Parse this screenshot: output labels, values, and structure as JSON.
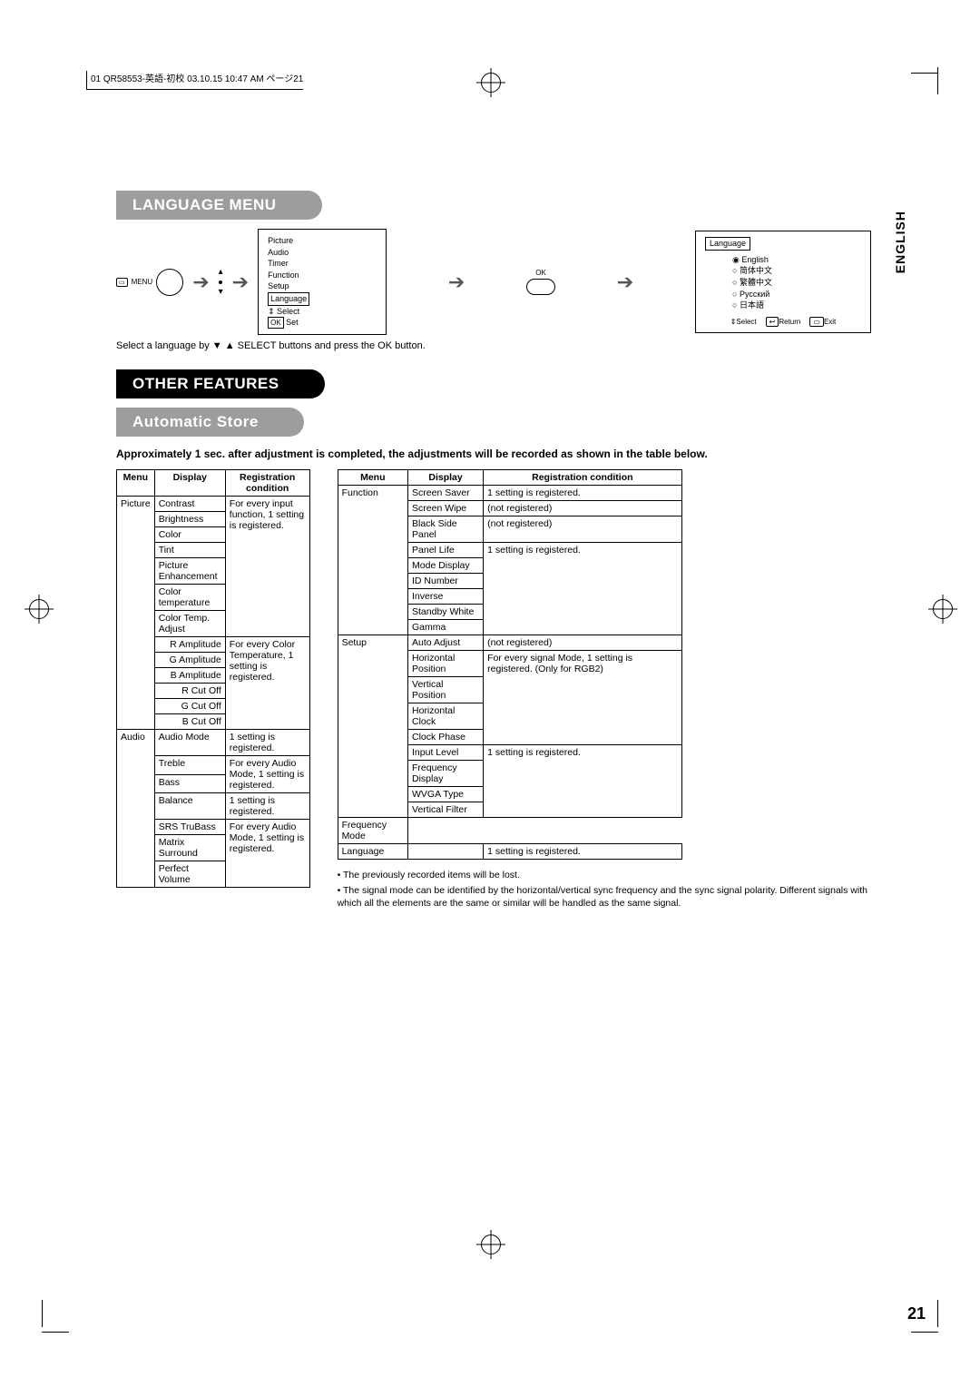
{
  "headerInfo": "01 QR58553-英語-初校  03.10.15  10:47 AM  ページ21",
  "langTab": "ENGLISH",
  "section1": "LANGUAGE MENU",
  "menuBtnLabel": "MENU",
  "okBtnLabel": "OK",
  "osdMenu": {
    "items": [
      "Picture",
      "Audio",
      "Timer",
      "Function",
      "Setup"
    ],
    "highlighted": "Language",
    "selectLabel": "Select",
    "setLabel": "Set",
    "okFrame": "OK"
  },
  "osdLanguage": {
    "title": "Language",
    "options": [
      "English",
      "简体中文",
      "繁體中文",
      "Русский",
      "日本語"
    ],
    "selectedIndex": 0,
    "footer": {
      "select": "Select",
      "return": "Return",
      "exit": "Exit"
    }
  },
  "caption1": "Select a language by ▼ ▲ SELECT buttons and press the OK button.",
  "section2": "OTHER FEATURES",
  "section3": "Automatic Store",
  "boldCaption": "Approximately 1 sec. after adjustment is completed, the adjustments will be recorded as shown in the table below.",
  "tableHeaders": {
    "menu": "Menu",
    "display": "Display",
    "cond": "Registration condition"
  },
  "tableLeft": [
    {
      "menu": "Picture",
      "display": "Contrast",
      "cond": "For every input function, 1 setting is registered.",
      "menuSpan": 13,
      "condSpan": 7
    },
    {
      "display": "Brightness"
    },
    {
      "display": "Color"
    },
    {
      "display": "Tint"
    },
    {
      "display": "Picture Enhancement"
    },
    {
      "display": "Color temperature"
    },
    {
      "display": "Color Temp. Adjust"
    },
    {
      "display": "R Amplitude",
      "cond": "For every Color Temperature, 1 setting is registered.",
      "condSpan": 6,
      "indent": true
    },
    {
      "display": "G Amplitude",
      "indent": true
    },
    {
      "display": "B Amplitude",
      "indent": true
    },
    {
      "display": "R Cut Off",
      "indent": true
    },
    {
      "display": "G Cut Off",
      "indent": true
    },
    {
      "display": "B Cut Off",
      "indent": true
    },
    {
      "menu": "Audio",
      "display": "Audio Mode",
      "cond": "1 setting is registered.",
      "menuSpan": 7
    },
    {
      "display": "Treble",
      "cond": "For every Audio Mode, 1 setting is registered.",
      "condSpan": 2
    },
    {
      "display": "Bass"
    },
    {
      "display": "Balance",
      "cond": "1 setting is registered."
    },
    {
      "display": "SRS TruBass",
      "cond": "For every Audio Mode, 1 setting is registered.",
      "condSpan": 3
    },
    {
      "display": "Matrix Surround"
    },
    {
      "display": "Perfect Volume"
    }
  ],
  "tableRight": [
    {
      "menu": "Function",
      "display": "Screen Saver",
      "cond": "1 setting is registered.",
      "menuSpan": 9
    },
    {
      "display": "Screen Wipe",
      "cond": "(not registered)"
    },
    {
      "display": "Black Side Panel",
      "cond": "(not registered)"
    },
    {
      "display": "Panel Life",
      "cond": "1 setting is registered.",
      "condSpan": 6
    },
    {
      "display": "Mode Display"
    },
    {
      "display": "ID Number"
    },
    {
      "display": "Inverse"
    },
    {
      "display": "Standby White"
    },
    {
      "display": "Gamma"
    },
    {
      "menu": "Setup",
      "display": "Auto Adjust",
      "cond": "(not registered)",
      "menuSpan": 9
    },
    {
      "display": "Horizontal Position",
      "cond": "For every signal Mode, 1 setting is registered. (Only for RGB2)",
      "condSpan": 4
    },
    {
      "display": "Vertical Position"
    },
    {
      "display": "Horizontal Clock"
    },
    {
      "display": "Clock Phase"
    },
    {
      "display": "Input Level",
      "cond": "1 setting is registered.",
      "condSpan": 4
    },
    {
      "display": "Frequency Display"
    },
    {
      "display": "WVGA Type"
    },
    {
      "display": "Vertical Filter"
    },
    {
      "display": "Frequency Mode"
    },
    {
      "menu": "Language",
      "display": "",
      "cond": "1 setting is registered."
    }
  ],
  "notes": [
    "The previously recorded items will be lost.",
    "The signal mode can be identified by the horizontal/vertical sync frequency and the sync signal polarity. Different signals with which all the elements are the same or similar will be handled as the same signal."
  ],
  "pageNum": "21"
}
